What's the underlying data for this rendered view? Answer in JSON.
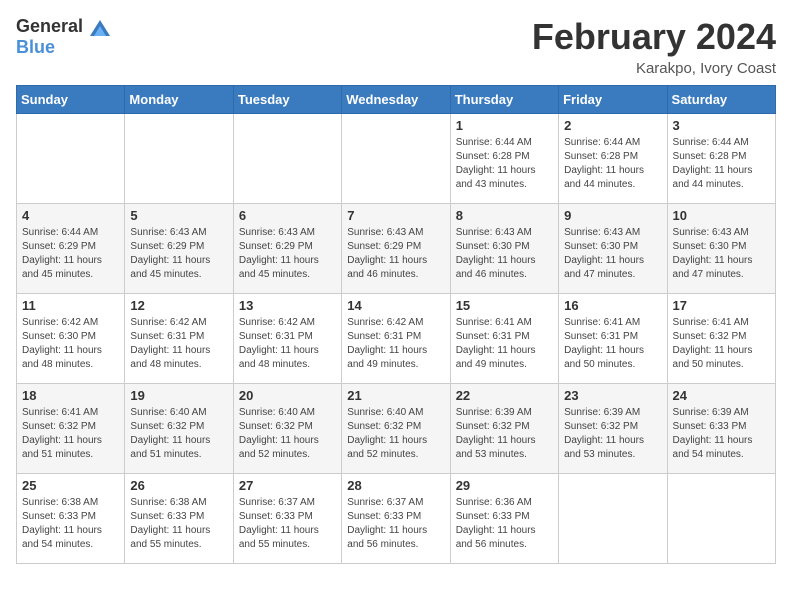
{
  "logo": {
    "general": "General",
    "blue": "Blue"
  },
  "title": "February 2024",
  "location": "Karakpo, Ivory Coast",
  "days_of_week": [
    "Sunday",
    "Monday",
    "Tuesday",
    "Wednesday",
    "Thursday",
    "Friday",
    "Saturday"
  ],
  "weeks": [
    [
      {
        "day": "",
        "sunrise": "",
        "sunset": "",
        "daylight": ""
      },
      {
        "day": "",
        "sunrise": "",
        "sunset": "",
        "daylight": ""
      },
      {
        "day": "",
        "sunrise": "",
        "sunset": "",
        "daylight": ""
      },
      {
        "day": "",
        "sunrise": "",
        "sunset": "",
        "daylight": ""
      },
      {
        "day": "1",
        "sunrise": "Sunrise: 6:44 AM",
        "sunset": "Sunset: 6:28 PM",
        "daylight": "Daylight: 11 hours and 43 minutes."
      },
      {
        "day": "2",
        "sunrise": "Sunrise: 6:44 AM",
        "sunset": "Sunset: 6:28 PM",
        "daylight": "Daylight: 11 hours and 44 minutes."
      },
      {
        "day": "3",
        "sunrise": "Sunrise: 6:44 AM",
        "sunset": "Sunset: 6:28 PM",
        "daylight": "Daylight: 11 hours and 44 minutes."
      }
    ],
    [
      {
        "day": "4",
        "sunrise": "Sunrise: 6:44 AM",
        "sunset": "Sunset: 6:29 PM",
        "daylight": "Daylight: 11 hours and 45 minutes."
      },
      {
        "day": "5",
        "sunrise": "Sunrise: 6:43 AM",
        "sunset": "Sunset: 6:29 PM",
        "daylight": "Daylight: 11 hours and 45 minutes."
      },
      {
        "day": "6",
        "sunrise": "Sunrise: 6:43 AM",
        "sunset": "Sunset: 6:29 PM",
        "daylight": "Daylight: 11 hours and 45 minutes."
      },
      {
        "day": "7",
        "sunrise": "Sunrise: 6:43 AM",
        "sunset": "Sunset: 6:29 PM",
        "daylight": "Daylight: 11 hours and 46 minutes."
      },
      {
        "day": "8",
        "sunrise": "Sunrise: 6:43 AM",
        "sunset": "Sunset: 6:30 PM",
        "daylight": "Daylight: 11 hours and 46 minutes."
      },
      {
        "day": "9",
        "sunrise": "Sunrise: 6:43 AM",
        "sunset": "Sunset: 6:30 PM",
        "daylight": "Daylight: 11 hours and 47 minutes."
      },
      {
        "day": "10",
        "sunrise": "Sunrise: 6:43 AM",
        "sunset": "Sunset: 6:30 PM",
        "daylight": "Daylight: 11 hours and 47 minutes."
      }
    ],
    [
      {
        "day": "11",
        "sunrise": "Sunrise: 6:42 AM",
        "sunset": "Sunset: 6:30 PM",
        "daylight": "Daylight: 11 hours and 48 minutes."
      },
      {
        "day": "12",
        "sunrise": "Sunrise: 6:42 AM",
        "sunset": "Sunset: 6:31 PM",
        "daylight": "Daylight: 11 hours and 48 minutes."
      },
      {
        "day": "13",
        "sunrise": "Sunrise: 6:42 AM",
        "sunset": "Sunset: 6:31 PM",
        "daylight": "Daylight: 11 hours and 48 minutes."
      },
      {
        "day": "14",
        "sunrise": "Sunrise: 6:42 AM",
        "sunset": "Sunset: 6:31 PM",
        "daylight": "Daylight: 11 hours and 49 minutes."
      },
      {
        "day": "15",
        "sunrise": "Sunrise: 6:41 AM",
        "sunset": "Sunset: 6:31 PM",
        "daylight": "Daylight: 11 hours and 49 minutes."
      },
      {
        "day": "16",
        "sunrise": "Sunrise: 6:41 AM",
        "sunset": "Sunset: 6:31 PM",
        "daylight": "Daylight: 11 hours and 50 minutes."
      },
      {
        "day": "17",
        "sunrise": "Sunrise: 6:41 AM",
        "sunset": "Sunset: 6:32 PM",
        "daylight": "Daylight: 11 hours and 50 minutes."
      }
    ],
    [
      {
        "day": "18",
        "sunrise": "Sunrise: 6:41 AM",
        "sunset": "Sunset: 6:32 PM",
        "daylight": "Daylight: 11 hours and 51 minutes."
      },
      {
        "day": "19",
        "sunrise": "Sunrise: 6:40 AM",
        "sunset": "Sunset: 6:32 PM",
        "daylight": "Daylight: 11 hours and 51 minutes."
      },
      {
        "day": "20",
        "sunrise": "Sunrise: 6:40 AM",
        "sunset": "Sunset: 6:32 PM",
        "daylight": "Daylight: 11 hours and 52 minutes."
      },
      {
        "day": "21",
        "sunrise": "Sunrise: 6:40 AM",
        "sunset": "Sunset: 6:32 PM",
        "daylight": "Daylight: 11 hours and 52 minutes."
      },
      {
        "day": "22",
        "sunrise": "Sunrise: 6:39 AM",
        "sunset": "Sunset: 6:32 PM",
        "daylight": "Daylight: 11 hours and 53 minutes."
      },
      {
        "day": "23",
        "sunrise": "Sunrise: 6:39 AM",
        "sunset": "Sunset: 6:32 PM",
        "daylight": "Daylight: 11 hours and 53 minutes."
      },
      {
        "day": "24",
        "sunrise": "Sunrise: 6:39 AM",
        "sunset": "Sunset: 6:33 PM",
        "daylight": "Daylight: 11 hours and 54 minutes."
      }
    ],
    [
      {
        "day": "25",
        "sunrise": "Sunrise: 6:38 AM",
        "sunset": "Sunset: 6:33 PM",
        "daylight": "Daylight: 11 hours and 54 minutes."
      },
      {
        "day": "26",
        "sunrise": "Sunrise: 6:38 AM",
        "sunset": "Sunset: 6:33 PM",
        "daylight": "Daylight: 11 hours and 55 minutes."
      },
      {
        "day": "27",
        "sunrise": "Sunrise: 6:37 AM",
        "sunset": "Sunset: 6:33 PM",
        "daylight": "Daylight: 11 hours and 55 minutes."
      },
      {
        "day": "28",
        "sunrise": "Sunrise: 6:37 AM",
        "sunset": "Sunset: 6:33 PM",
        "daylight": "Daylight: 11 hours and 56 minutes."
      },
      {
        "day": "29",
        "sunrise": "Sunrise: 6:36 AM",
        "sunset": "Sunset: 6:33 PM",
        "daylight": "Daylight: 11 hours and 56 minutes."
      },
      {
        "day": "",
        "sunrise": "",
        "sunset": "",
        "daylight": ""
      },
      {
        "day": "",
        "sunrise": "",
        "sunset": "",
        "daylight": ""
      }
    ]
  ]
}
